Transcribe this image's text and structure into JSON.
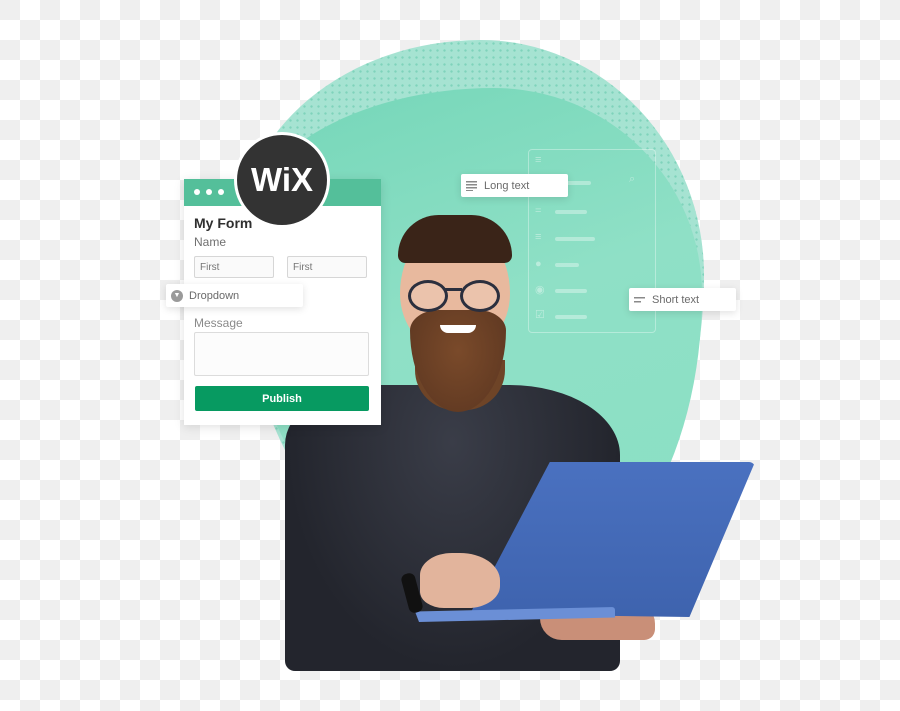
{
  "form": {
    "title": "My Form",
    "name_label": "Name",
    "first_name_placeholder": "First",
    "last_name_placeholder": "First",
    "message_label": "Message",
    "message_value": "",
    "publish_label": "Publish",
    "header_color": "#54bf9a",
    "button_color": "#079a61"
  },
  "brand": {
    "logo_text": "WiX",
    "logo_bg": "#333333"
  },
  "chips": {
    "dropdown": {
      "label": "Dropdown",
      "icon": "dropdown-circle-icon"
    },
    "long_text": {
      "label": "Long text",
      "icon": "long-text-lines-icon"
    },
    "short_text": {
      "label": "Short text",
      "icon": "short-text-lines-icon"
    }
  },
  "ghost_panel": {
    "icons": [
      "menu-icon",
      "search-icon",
      "short-text-icon",
      "long-text-icon",
      "dropdown-icon",
      "radio-icon",
      "checkbox-icon"
    ]
  },
  "colors": {
    "blob_light": "#a6e3d2",
    "blob": "#8fe0c6",
    "laptop": "#4a71c0",
    "shirt": "#23252d"
  }
}
